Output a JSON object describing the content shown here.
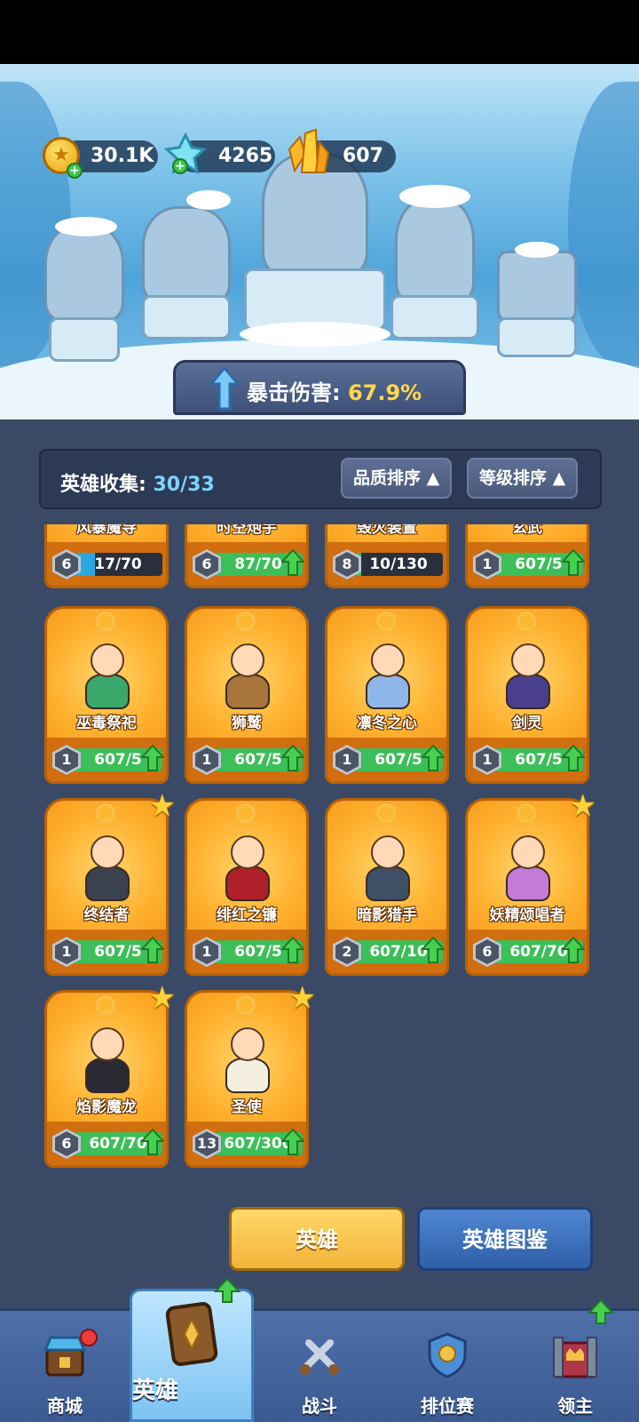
{
  "resources": {
    "gold": "30.1K",
    "diamond": "4265",
    "crystal": "607"
  },
  "stat": {
    "label": "暴击伤害:",
    "value": "67.9%"
  },
  "collection": {
    "label": "英雄收集:",
    "count": "30/33",
    "sort_quality": "品质排序",
    "sort_level": "等级排序"
  },
  "heroes_partial": [
    {
      "name": "风暴魔导",
      "level": "6",
      "progress": "17/70",
      "fill": 0.24,
      "bar": "blue",
      "can_upgrade": false
    },
    {
      "name": "时空炮手",
      "level": "6",
      "progress": "87/70",
      "fill": 1.0,
      "bar": "green",
      "can_upgrade": true
    },
    {
      "name": "毁灭装置",
      "level": "8",
      "progress": "10/130",
      "fill": 0.08,
      "bar": "green",
      "can_upgrade": false
    },
    {
      "name": "玄武",
      "level": "1",
      "progress": "607/5",
      "fill": 1.0,
      "bar": "green",
      "can_upgrade": true
    }
  ],
  "heroes": [
    {
      "name": "巫毒祭祀",
      "level": "1",
      "progress": "607/5",
      "fill": 1.0,
      "starred": false,
      "tint": "#3aa86a"
    },
    {
      "name": "狮鹫",
      "level": "1",
      "progress": "607/5",
      "fill": 1.0,
      "starred": false,
      "tint": "#a8753a"
    },
    {
      "name": "凛冬之心",
      "level": "1",
      "progress": "607/5",
      "fill": 1.0,
      "starred": false,
      "tint": "#8fb6e8"
    },
    {
      "name": "剑灵",
      "level": "1",
      "progress": "607/5",
      "fill": 1.0,
      "starred": false,
      "tint": "#4a3f8a"
    },
    {
      "name": "终结者",
      "level": "1",
      "progress": "607/5",
      "fill": 1.0,
      "starred": true,
      "tint": "#3a4250"
    },
    {
      "name": "绯红之镰",
      "level": "1",
      "progress": "607/5",
      "fill": 1.0,
      "starred": false,
      "tint": "#b0202a"
    },
    {
      "name": "暗影猎手",
      "level": "2",
      "progress": "607/10",
      "fill": 1.0,
      "starred": false,
      "tint": "#3f4f66"
    },
    {
      "name": "妖精颂唱者",
      "level": "6",
      "progress": "607/70",
      "fill": 1.0,
      "starred": true,
      "tint": "#c47ad6"
    },
    {
      "name": "焰影魔龙",
      "level": "6",
      "progress": "607/70",
      "fill": 1.0,
      "starred": true,
      "tint": "#2a2a34"
    },
    {
      "name": "圣使",
      "level": "13",
      "progress": "607/300",
      "fill": 1.0,
      "starred": true,
      "tint": "#f4f0e0"
    }
  ],
  "buttons": {
    "heroes": "英雄",
    "atlas": "英雄图鉴"
  },
  "nav": {
    "shop": "商城",
    "heroes": "英雄",
    "battle": "战斗",
    "ranked": "排位赛",
    "lord": "领主"
  },
  "icons": {
    "gold": "coin-icon",
    "diamond": "diamond-icon",
    "crystal": "crystal-icon"
  }
}
